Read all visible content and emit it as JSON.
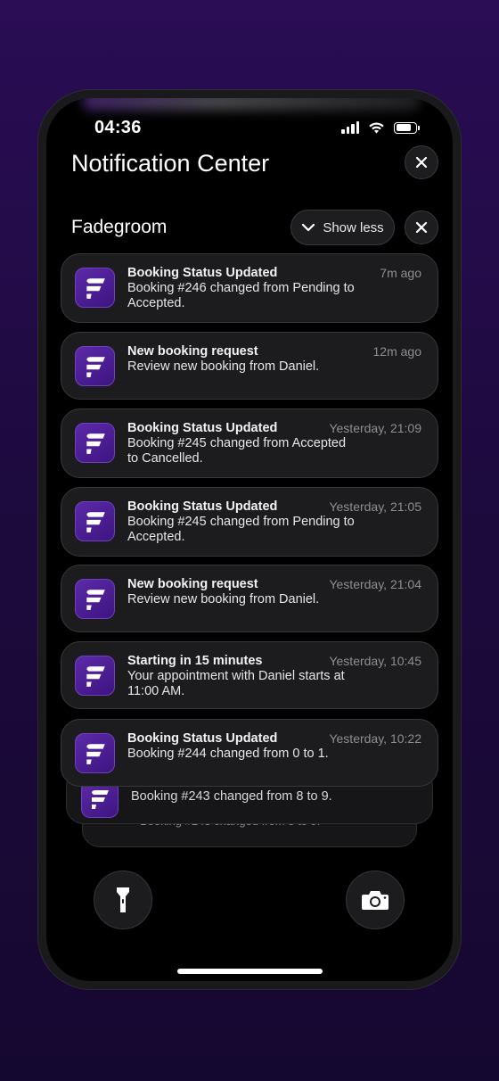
{
  "status_bar": {
    "time": "04:36",
    "battery_level": 0.8
  },
  "header": {
    "title": "Notification Center",
    "close_icon": "close-icon"
  },
  "group": {
    "title": "Fadegroom",
    "show_less_label": "Show less",
    "chevron_icon": "chevron-down-icon"
  },
  "notifications": [
    {
      "title": "Booking Status Updated",
      "time": "7m ago",
      "body": "Booking #246 changed from Pending to Accepted."
    },
    {
      "title": "New booking request",
      "time": "12m ago",
      "body": "Review new booking from Daniel."
    },
    {
      "title": "Booking Status Updated",
      "time": "Yesterday, 21:09",
      "body": "Booking #245 changed from Accepted to Cancelled."
    },
    {
      "title": "Booking Status Updated",
      "time": "Yesterday, 21:05",
      "body": "Booking #245 changed from Pending to Accepted."
    },
    {
      "title": "New booking request",
      "time": "Yesterday, 21:04",
      "body": "Review new booking from Daniel."
    },
    {
      "title": "Starting in 15 minutes",
      "time": "Yesterday, 10:45",
      "body": "Your appointment with Daniel starts at 11:00 AM."
    },
    {
      "title": "Booking Status Updated",
      "time": "Yesterday, 10:22",
      "body": "Booking #244 changed from 0 to 1."
    }
  ],
  "stacked": [
    {
      "body": "Booking #243 changed from 8 to 9."
    },
    {
      "body": "Booking #243 changed from 8 to 9."
    }
  ],
  "bottom": {
    "left_icon": "flashlight-icon",
    "right_icon": "camera-icon"
  },
  "colors": {
    "brand": "#4b1d96",
    "background": "#1f0a45",
    "card": "#1c1c1e"
  }
}
